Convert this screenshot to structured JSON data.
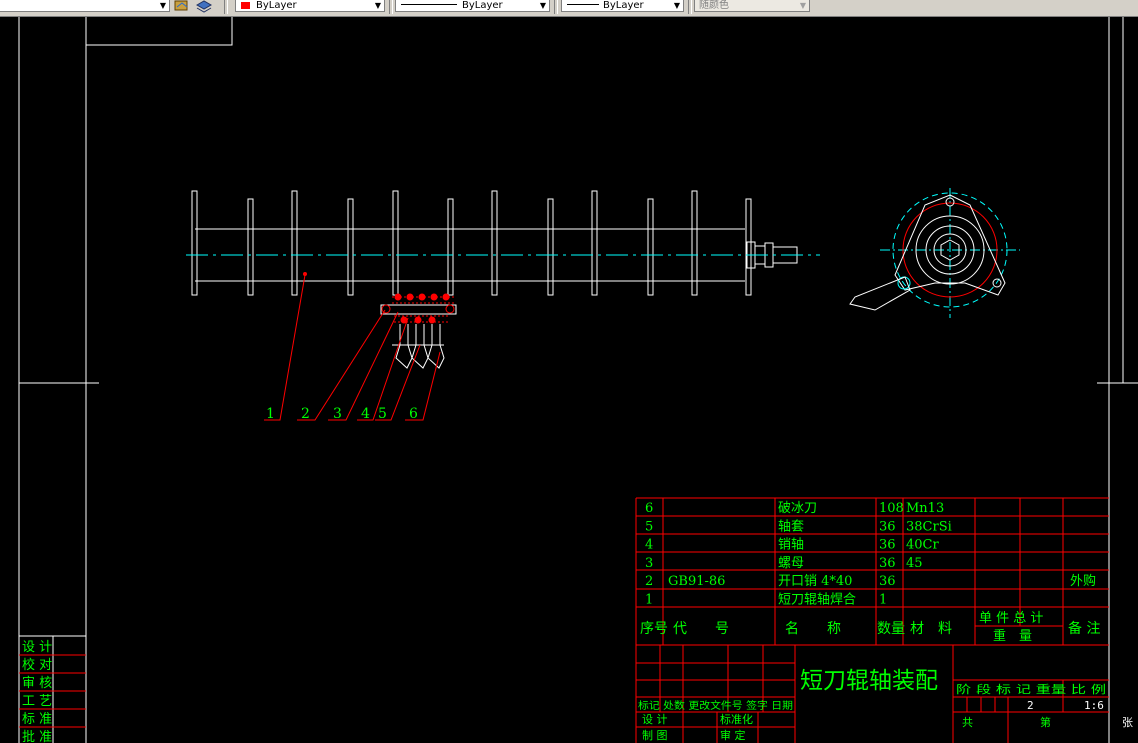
{
  "toolbar": {
    "color_combo": "ByLayer",
    "linetype_combo": "ByLayer",
    "lineweight_combo": "ByLayer",
    "plotstyle_combo": "随颜色",
    "accent_red": "#ff0000"
  },
  "drawing": {
    "title": "短刀辊轴装配",
    "balloons": [
      "1",
      "2",
      "3",
      "4",
      "5",
      "6"
    ],
    "parts": [
      {
        "no": "6",
        "code": "",
        "name": "破冰刀",
        "qty": "108",
        "material": "Mn13",
        "note": ""
      },
      {
        "no": "5",
        "code": "",
        "name": "轴套",
        "qty": "36",
        "material": "38CrSi",
        "note": ""
      },
      {
        "no": "4",
        "code": "",
        "name": "销轴",
        "qty": "36",
        "material": "40Cr",
        "note": ""
      },
      {
        "no": "3",
        "code": "",
        "name": "螺母",
        "qty": "36",
        "material": "45",
        "note": ""
      },
      {
        "no": "2",
        "code": "GB91-86",
        "name": "开口销 4*40",
        "qty": "36",
        "material": "",
        "note": "外购"
      },
      {
        "no": "1",
        "code": "",
        "name": "短刀辊轴焊合",
        "qty": "1",
        "material": "",
        "note": ""
      }
    ],
    "header": {
      "no": "序号",
      "code": "代　　号",
      "name": "名　　称",
      "qty": "数量",
      "material": "材　料",
      "unit_total_top": "单 件 总 计",
      "unit_total_bottom": "重　量",
      "note": "备 注"
    },
    "left_column": [
      "设 计",
      "校 对",
      "审 核",
      "工 艺",
      "标 准",
      "批 准"
    ],
    "revision_row": "标记 处数 更改文件号 签字 日期",
    "sign_row1": [
      "设 计",
      "标准化"
    ],
    "sign_row2": [
      "制 图",
      "审 定"
    ],
    "stage_row": "阶 段 标 记 重量 比 例",
    "quantity": "2",
    "scale": "1:6",
    "sheet_total": "共",
    "sheet_no": "第",
    "sheet_unit": "张"
  },
  "colors": {
    "text_green": "#00ff00",
    "leader_red": "#ff0000",
    "centerline_cyan": "#00ffff",
    "line_white": "#ffffff"
  }
}
